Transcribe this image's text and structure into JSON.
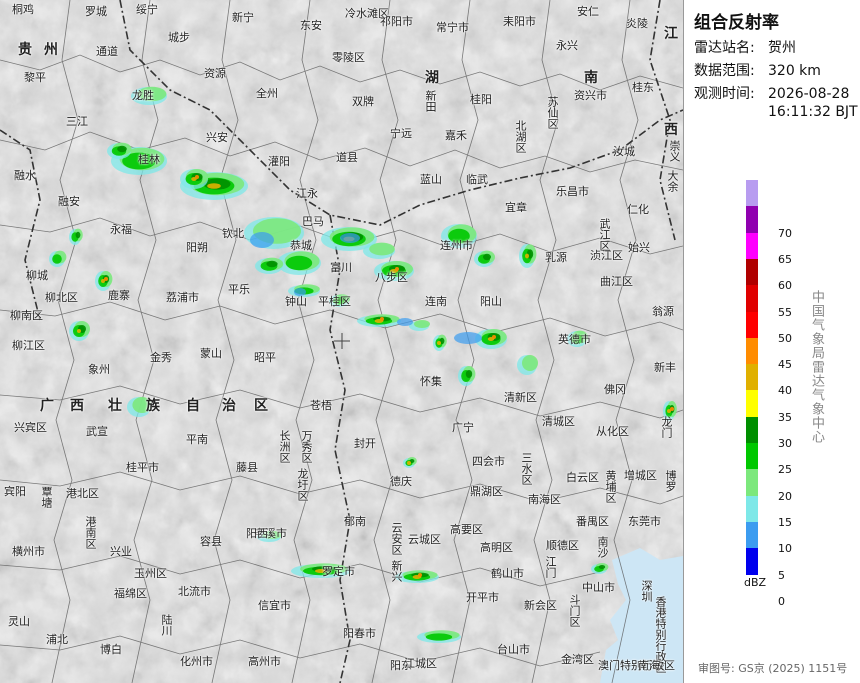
{
  "panel": {
    "title": "组合反射率",
    "station_label": "雷达站名:",
    "station_value": "贺州",
    "range_label": "数据范围:",
    "range_value": "320 km",
    "time_label": "观测时间:",
    "time_date": "2026-08-28",
    "time_clock": "16:11:32 BJT",
    "org": "中国气象局雷达气象中心",
    "unit": "dBZ",
    "review": "审图号: GS京 (2025) 1151号"
  },
  "legend": [
    {
      "label": "",
      "color": "#b89cf0"
    },
    {
      "label": "70",
      "color": "#9000b0"
    },
    {
      "label": "65",
      "color": "#ff00ff"
    },
    {
      "label": "60",
      "color": "#b00000"
    },
    {
      "label": "55",
      "color": "#e00000"
    },
    {
      "label": "50",
      "color": "#ff0000"
    },
    {
      "label": "45",
      "color": "#ff8c00"
    },
    {
      "label": "40",
      "color": "#e0b000"
    },
    {
      "label": "35",
      "color": "#ffff00"
    },
    {
      "label": "30",
      "color": "#008f00"
    },
    {
      "label": "25",
      "color": "#00c800"
    },
    {
      "label": "20",
      "color": "#7ce87c"
    },
    {
      "label": "15",
      "color": "#7ee8e8"
    },
    {
      "label": "10",
      "color": "#3c9cf0"
    },
    {
      "label": "5",
      "color": "#0000ee"
    },
    {
      "label": "0",
      "color": "#ffffff"
    }
  ],
  "map_labels": {
    "l1": "桐鸡",
    "l2": "罗城",
    "l3": "绥宁",
    "l4": "新宁",
    "l5": "东安",
    "l6": "冷水滩区",
    "l7": "祁阳市",
    "l8": "常宁市",
    "l9": "耒阳市",
    "l10": "安仁",
    "l11": "炎陵",
    "l12": "贵",
    "l13": "州",
    "l14": "黎平",
    "l15": "通道",
    "l16": "城步",
    "l17": "资源",
    "l18": "全州",
    "l19": "零陵区",
    "l20": "湖",
    "l21": "南",
    "l22": "永兴",
    "l23": "资兴市",
    "l24": "桂东",
    "l25": "江",
    "l26": "西",
    "l27": "三江",
    "l28": "龙胜",
    "l29": "兴安",
    "l30": "灌阳",
    "l31": "双牌",
    "l32": "宁远",
    "l33": "新田",
    "l34": "桂阳",
    "l35": "嘉禾",
    "l36": "苏仙区",
    "l37": "北湖区",
    "l38": "汝城",
    "l39": "崇义",
    "l40": "融水",
    "l41": "融安",
    "l42": "永福",
    "l43": "桂林",
    "l44": "道县",
    "l45": "蓝山",
    "l46": "临武",
    "l47": "宜章",
    "l48": "乐昌市",
    "l49": "仁化",
    "l50": "大余",
    "l51": "江永",
    "l52": "柳城",
    "l53": "鹿寨",
    "l54": "阳朔",
    "l55": "恭城",
    "l56": "富川",
    "l57": "连州市",
    "l58": "乳源",
    "l59": "浈江区",
    "l60": "武江区",
    "l61": "始兴",
    "l62": "曲江区",
    "l63": "翁源",
    "l64": "柳北区",
    "l65": "柳南区",
    "l66": "柳江区",
    "l67": "象州",
    "l68": "荔浦市",
    "l69": "平乐",
    "l70": "钟山",
    "l71": "八步区",
    "l72": "连南",
    "l73": "阳山",
    "l74": "英德市",
    "l75": "新丰",
    "l76": "金秀",
    "l77": "蒙山",
    "l78": "昭平",
    "l79": "广",
    "l80": "西",
    "l81": "壮",
    "l82": "族",
    "l83": "自",
    "l84": "治",
    "l85": "区",
    "l86": "怀集",
    "l87": "清新区",
    "l88": "佛冈",
    "l89": "龙门",
    "l90": "兴宾区",
    "l91": "武宣",
    "l92": "平南",
    "l93": "藤县",
    "l94": "苍梧",
    "l95": "封开",
    "l96": "广宁",
    "l97": "四会市",
    "l98": "清城区",
    "l99": "从化区",
    "l100": "增城区",
    "l101": "博罗",
    "l102": "桂平市",
    "l103": "宾阳",
    "l104": "港北区",
    "l105": "覃塘",
    "l106": "港南区",
    "l107": "德庆",
    "l108": "鼎湖区",
    "l109": "南海区",
    "l110": "白云区",
    "l111": "黄埔区",
    "l112": "东莞市",
    "l113": "横州市",
    "l114": "兴业",
    "l115": "容县",
    "l116": "岑溪市",
    "l117": "郁南",
    "l118": "云城区",
    "l119": "高要区",
    "l120": "高明区",
    "l121": "顺德区",
    "l122": "番禺区",
    "l123": "南沙",
    "l124": "玉州区",
    "l125": "福绵区",
    "l126": "北流市",
    "l127": "罗定市",
    "l128": "新兴",
    "l129": "鹤山市",
    "l130": "江门",
    "l131": "中山市",
    "l132": "深圳",
    "l133": "灵山",
    "l134": "浦北",
    "l135": "陆川",
    "l136": "信宜市",
    "l137": "阳春市",
    "l138": "开平市",
    "l139": "新会区",
    "l140": "斗门区",
    "l141": "香港特别行政区",
    "l142": "博白",
    "l143": "化州市",
    "l144": "高州市",
    "l145": "阳东",
    "l146": "台山市",
    "l147": "金湾区",
    "l148": "澳门特别行政区",
    "l149": "南海",
    "l150": "钦北",
    "l151": "巴马",
    "l152": "平桂区",
    "l153": "长洲区",
    "l154": "万秀区",
    "l155": "龙圩区",
    "l156": "阳西",
    "l157": "江城区",
    "l158": "云安区",
    "l159": "三水区"
  }
}
